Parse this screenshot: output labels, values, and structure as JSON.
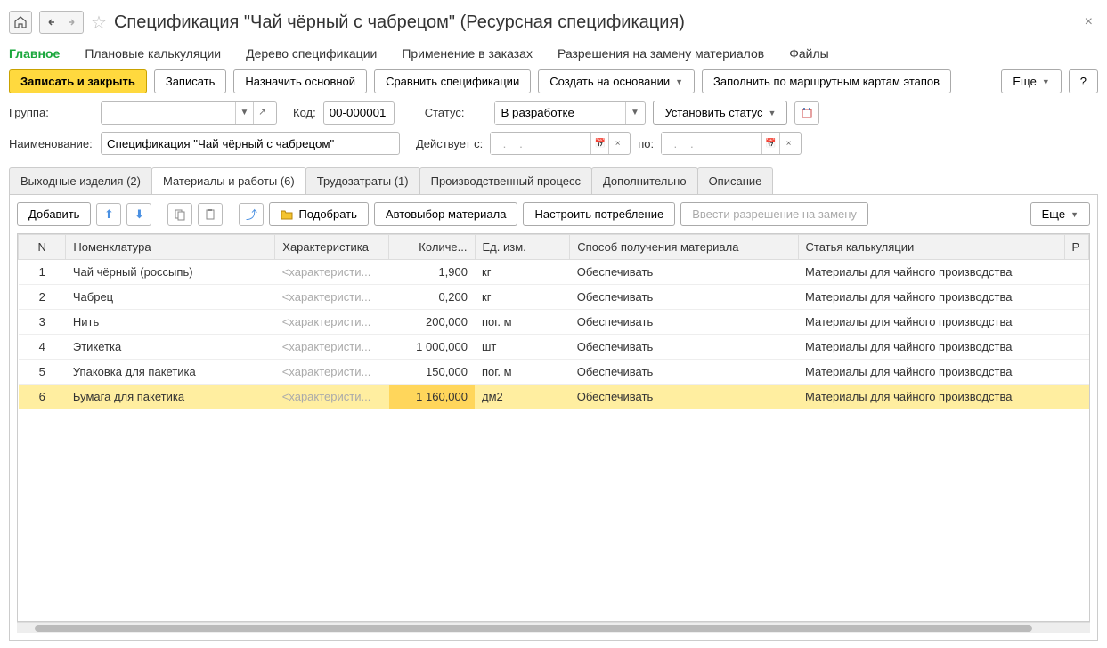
{
  "title": "Спецификация \"Чай чёрный с чабрецом\" (Ресурсная спецификация)",
  "menu": {
    "main": "Главное",
    "plan": "Плановые калькуляции",
    "tree": "Дерево спецификации",
    "orders": "Применение в заказах",
    "permissions": "Разрешения на замену материалов",
    "files": "Файлы"
  },
  "toolbar": {
    "save_close": "Записать и закрыть",
    "save": "Записать",
    "set_main": "Назначить основной",
    "compare": "Сравнить спецификации",
    "create_based": "Создать на основании",
    "fill_route": "Заполнить по маршрутным картам этапов",
    "more": "Еще",
    "help": "?"
  },
  "fields": {
    "group_label": "Группа:",
    "group_value": "",
    "code_label": "Код:",
    "code_value": "00-000001",
    "status_label": "Статус:",
    "status_value": "В разработке",
    "set_status": "Установить статус",
    "name_label": "Наименование:",
    "name_value": "Спецификация \"Чай чёрный с чабрецом\"",
    "valid_from": "Действует с:",
    "date_placeholder": "  .    .    ",
    "to": "по:"
  },
  "tabs": {
    "t1": "Выходные изделия (2)",
    "t2": "Материалы и работы (6)",
    "t3": "Трудозатраты (1)",
    "t4": "Производственный процесс",
    "t5": "Дополнительно",
    "t6": "Описание"
  },
  "tabtoolbar": {
    "add": "Добавить",
    "select": "Подобрать",
    "auto": "Автовыбор материала",
    "configure": "Настроить потребление",
    "permission": "Ввести разрешение на замену",
    "more": "Еще"
  },
  "columns": {
    "n": "N",
    "item": "Номенклатура",
    "char": "Характеристика",
    "qty": "Количе...",
    "unit": "Ед. изм.",
    "supply": "Способ получения материала",
    "article": "Статья калькуляции",
    "p": "Р"
  },
  "placeholder_char": "<характеристи...",
  "rows": [
    {
      "n": "1",
      "item": "Чай чёрный (россыпь)",
      "qty": "1,900",
      "unit": "кг",
      "supply": "Обеспечивать",
      "article": "Материалы для чайного производства",
      "selected": false
    },
    {
      "n": "2",
      "item": "Чабрец",
      "qty": "0,200",
      "unit": "кг",
      "supply": "Обеспечивать",
      "article": "Материалы для чайного производства",
      "selected": false
    },
    {
      "n": "3",
      "item": "Нить",
      "qty": "200,000",
      "unit": "пог. м",
      "supply": "Обеспечивать",
      "article": "Материалы для чайного производства",
      "selected": false
    },
    {
      "n": "4",
      "item": "Этикетка",
      "qty": "1 000,000",
      "unit": "шт",
      "supply": "Обеспечивать",
      "article": "Материалы для чайного производства",
      "selected": false
    },
    {
      "n": "5",
      "item": "Упаковка для пакетика",
      "qty": "150,000",
      "unit": "пог. м",
      "supply": "Обеспечивать",
      "article": "Материалы для чайного производства",
      "selected": false
    },
    {
      "n": "6",
      "item": "Бумага для пакетика",
      "qty": "1 160,000",
      "unit": "дм2",
      "supply": "Обеспечивать",
      "article": "Материалы для чайного производства",
      "selected": true
    }
  ]
}
